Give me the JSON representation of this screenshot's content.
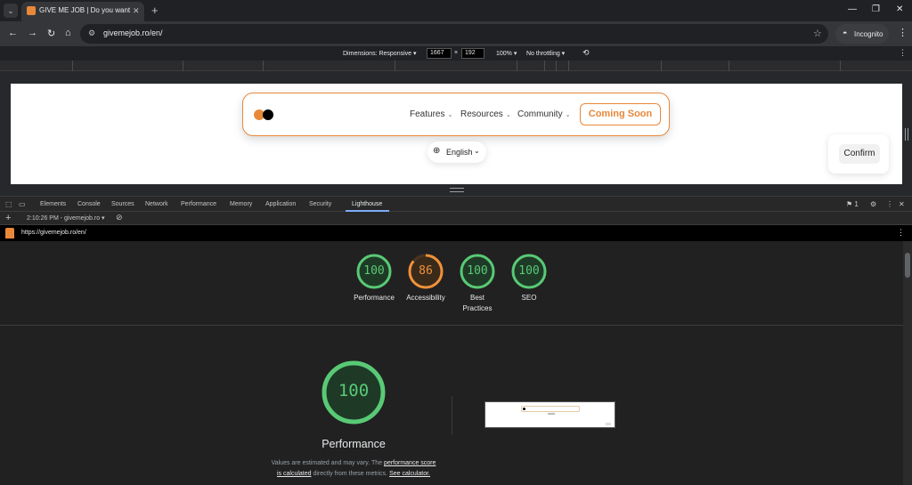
{
  "browser": {
    "tab_title": "GIVE ME JOB | Do you want to c",
    "url": "givemejob.ro/en/",
    "incognito_label": "Incognito"
  },
  "device_toolbar": {
    "dimensions_label": "Dimensions: Responsive ▾",
    "width": "1667",
    "times": "×",
    "height": "192",
    "zoom": "100% ▾",
    "throttling": "No throttling ▾"
  },
  "site": {
    "nav": [
      "Features",
      "Resources",
      "Community"
    ],
    "cta": "Coming Soon",
    "language": "English",
    "confirm": "Confirm",
    "brand_color": "#e8883a"
  },
  "devtools": {
    "tabs": [
      "Elements",
      "Console",
      "Sources",
      "Network",
      "Performance",
      "Memory",
      "Application",
      "Security",
      "Lighthouse"
    ],
    "active_tab": "Lighthouse",
    "issues_count": "1",
    "run_label": "2:10:26 PM - givemejob.ro ▾"
  },
  "lighthouse": {
    "report_url": "https://givemejob.ro/en/",
    "scores": [
      {
        "label": "Performance",
        "score": "100",
        "value": 1.0,
        "color": "#59c975"
      },
      {
        "label": "Accessibility",
        "score": "86",
        "value": 0.86,
        "color": "#f0913a"
      },
      {
        "label": "Best Practices",
        "score": "100",
        "value": 1.0,
        "color": "#59c975"
      },
      {
        "label": "SEO",
        "score": "100",
        "value": 1.0,
        "color": "#59c975"
      }
    ],
    "main": {
      "score": "100",
      "title": "Performance",
      "desc_1": "Values are estimated and may vary. The",
      "desc_link_1": "performance score",
      "desc_link_2": "is calculated",
      "desc_2": "directly from these metrics.",
      "desc_link_3": "See calculator."
    }
  }
}
